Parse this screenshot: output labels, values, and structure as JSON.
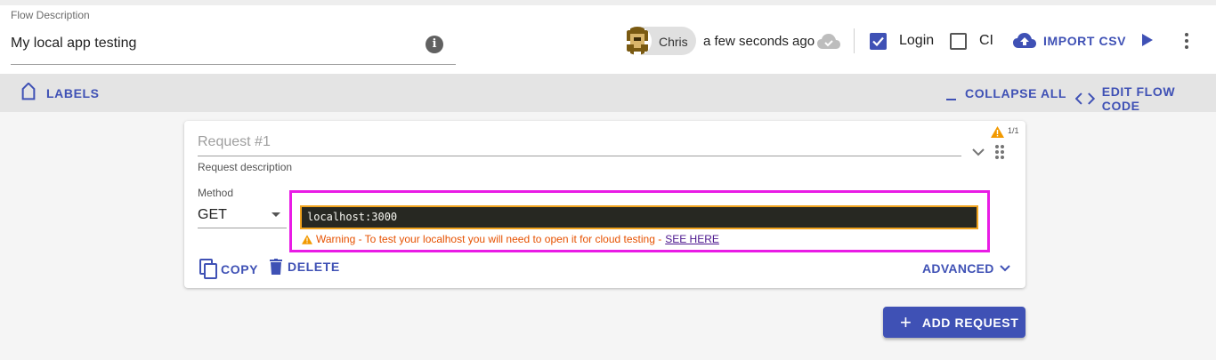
{
  "header": {
    "flow_description_label": "Flow Description",
    "flow_description_value": "My local app testing",
    "user_name": "Chris",
    "last_saved": "a few seconds ago",
    "login_label": "Login",
    "login_checked": true,
    "ci_label": "CI",
    "ci_checked": false,
    "import_csv_label": "IMPORT CSV"
  },
  "toolbar": {
    "labels_label": "LABELS",
    "collapse_all_label": "COLLAPSE ALL",
    "edit_flow_code_label": "EDIT FLOW CODE"
  },
  "request": {
    "title_placeholder": "Request #1",
    "description_label": "Request description",
    "warning_count": "1/1",
    "method_label": "Method",
    "method_value": "GET",
    "url_value": "localhost:3000",
    "warning_text": "Warning - To test your localhost you will need to open it for cloud testing -",
    "warning_link": "SEE HERE",
    "copy_label": "COPY",
    "delete_label": "DELETE",
    "advanced_label": "ADVANCED"
  },
  "footer": {
    "add_request_label": "ADD REQUEST"
  },
  "colors": {
    "accent": "#3f51b5",
    "warning": "#e65100",
    "highlight": "#e91be5",
    "editor_bg": "#272822"
  },
  "icons": [
    "info-icon",
    "cloud-done-icon",
    "cloud-upload-icon",
    "play-icon",
    "more-vert-icon",
    "label-icon",
    "collapse-icon",
    "code-icon",
    "warning-icon",
    "chevron-down-icon",
    "drag-handle-icon",
    "copy-icon",
    "delete-icon",
    "plus-icon"
  ]
}
